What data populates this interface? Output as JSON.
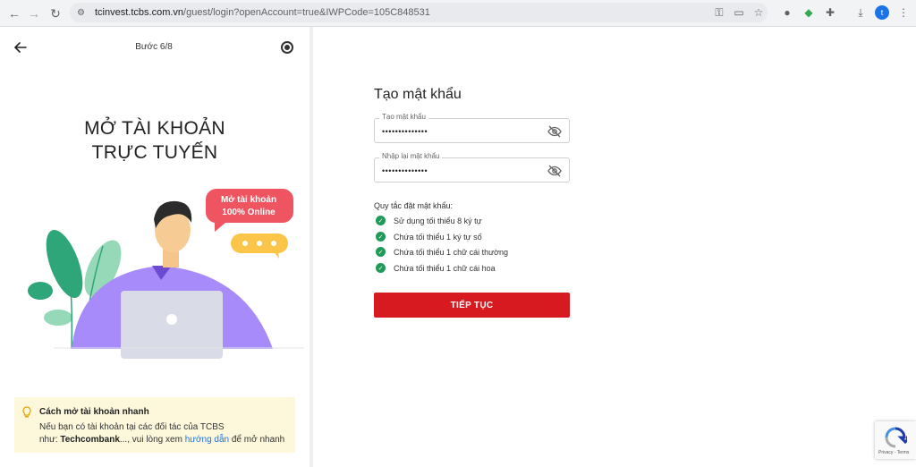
{
  "browser": {
    "url_host": "tcinvest.tcbs.com.vn",
    "url_path": "/guest/login?openAccount=true&IWPCode=105C848531",
    "profile_initial": "t"
  },
  "header": {
    "step": "Bước 6/8"
  },
  "hero": {
    "title_line1": "MỞ TÀI KHOẢN",
    "title_line2": "TRỰC TUYẾN",
    "bubble_line1": "Mở tài khoản",
    "bubble_line2": "100% Online"
  },
  "tip": {
    "title": "Cách mở tài khoản nhanh",
    "line1": "Nếu bạn có tài khoản tại các đối tác của TCBS",
    "line2_prefix": "như: ",
    "partner": "Techcombank",
    "line2_mid": "..., vui lòng xem ",
    "link": "hướng dẫn",
    "line2_suffix": " để mở nhanh"
  },
  "form": {
    "title": "Tạo mật khẩu",
    "password_label": "Tạo mật khẩu",
    "password_value": "••••••••••••••",
    "confirm_label": "Nhập lại mật khẩu",
    "confirm_value": "••••••••••••••",
    "rules_title": "Quy tắc đặt mật khẩu:",
    "rules": [
      "Sử dụng tối thiểu 8 ký tự",
      "Chứa tối thiểu 1 ký tự số",
      "Chứa tối thiểu 1 chữ cái thường",
      "Chứa tối thiểu 1 chữ cái hoa"
    ],
    "submit_label": "TIẾP TỤC"
  },
  "recaptcha": {
    "text": "Privacy - Terms"
  },
  "colors": {
    "brand_red": "#d71920",
    "check_green": "#1f9b58",
    "tip_bg": "#fdf8dc",
    "link_blue": "#1a73e8"
  }
}
